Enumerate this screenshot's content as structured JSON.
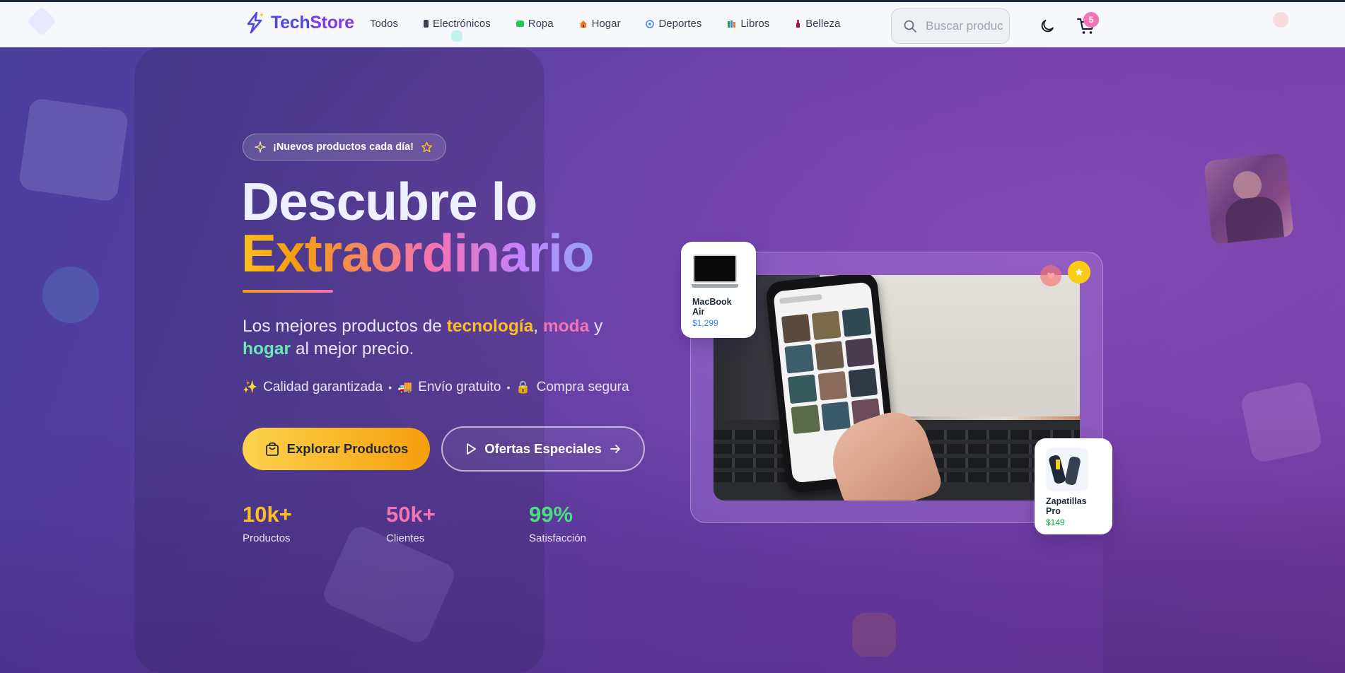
{
  "brand": {
    "name_part1": "Tech",
    "name_part2": "Store",
    "logo_icon": "lightning-bolt-icon"
  },
  "nav": {
    "items": [
      {
        "label": "Todos",
        "icon": ""
      },
      {
        "label": "Electrónicos",
        "icon": "phone-icon",
        "color": "#374151"
      },
      {
        "label": "Ropa",
        "icon": "shirt-icon",
        "color": "#22c55e"
      },
      {
        "label": "Hogar",
        "icon": "house-icon",
        "color": "#f97316"
      },
      {
        "label": "Deportes",
        "icon": "soccer-ball-icon",
        "color": "#3b82f6"
      },
      {
        "label": "Libros",
        "icon": "books-icon",
        "color": "#16a34a"
      },
      {
        "label": "Belleza",
        "icon": "lipstick-icon",
        "color": "#e11d48"
      }
    ]
  },
  "search": {
    "placeholder": "Buscar productos..."
  },
  "cart": {
    "count": "5"
  },
  "hero": {
    "badge": "¡Nuevos productos cada día!",
    "headline_line1": "Descubre lo",
    "headline_line2": "Extraordinario",
    "subtitle": {
      "prefix": "Los mejores productos de ",
      "word1": "tecnología",
      "comma": ", ",
      "word2": "moda",
      "and": " y ",
      "word3": "hogar",
      "suffix": " al mejor precio."
    },
    "features": [
      {
        "icon": "sparkles-icon",
        "glyph": "✨",
        "label": "Calidad garantizada"
      },
      {
        "icon": "delivery-truck-icon",
        "glyph": "🚚",
        "label": "Envío gratuito"
      },
      {
        "icon": "lock-icon",
        "glyph": "🔒",
        "label": "Compra segura"
      }
    ],
    "primary_cta": "Explorar Productos",
    "secondary_cta": "Ofertas Especiales",
    "stats": [
      {
        "value": "10k+",
        "label": "Productos",
        "color": "#fbbf24"
      },
      {
        "value": "50k+",
        "label": "Clientes",
        "color": "#f472b6"
      },
      {
        "value": "99%",
        "label": "Satisfacción",
        "color": "#4ade80"
      }
    ]
  },
  "product_cards": [
    {
      "name": "MacBook Air",
      "price": "$1,299",
      "price_color": "#3b82f6"
    },
    {
      "name": "Zapatillas Pro",
      "price": "$149",
      "price_color": "#16a34a"
    }
  ],
  "colors": {
    "accent": "#4f46e5",
    "cta": "#f59e0b",
    "hero_bg": "#5b3fa0"
  }
}
